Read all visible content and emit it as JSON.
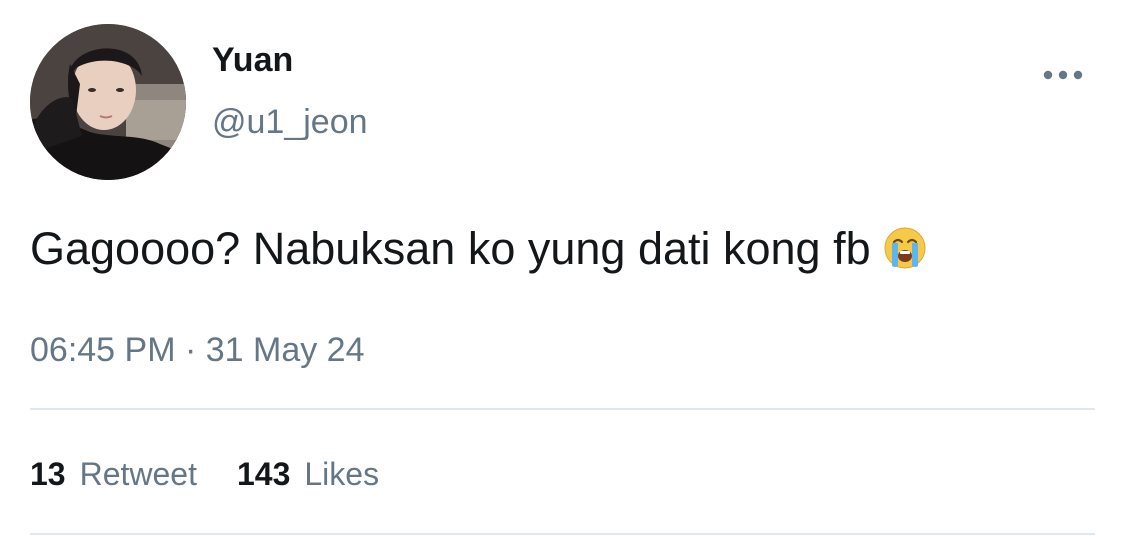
{
  "tweet": {
    "display_name": "Yuan",
    "handle": "@u1_jeon",
    "text": "Gagoooo? Nabuksan ko yung dati kong fb",
    "emoji": "loudly-crying-face",
    "timestamp": "06:45 PM · 31 May 24"
  },
  "stats": {
    "retweet_count": "13",
    "retweet_label": "Retweet",
    "likes_count": "143",
    "likes_label": "Likes"
  },
  "icons": {
    "more": "more-horizontal-icon"
  },
  "colors": {
    "primary_text": "#14171a",
    "secondary_text": "#657786",
    "divider": "#e1e8ed"
  }
}
